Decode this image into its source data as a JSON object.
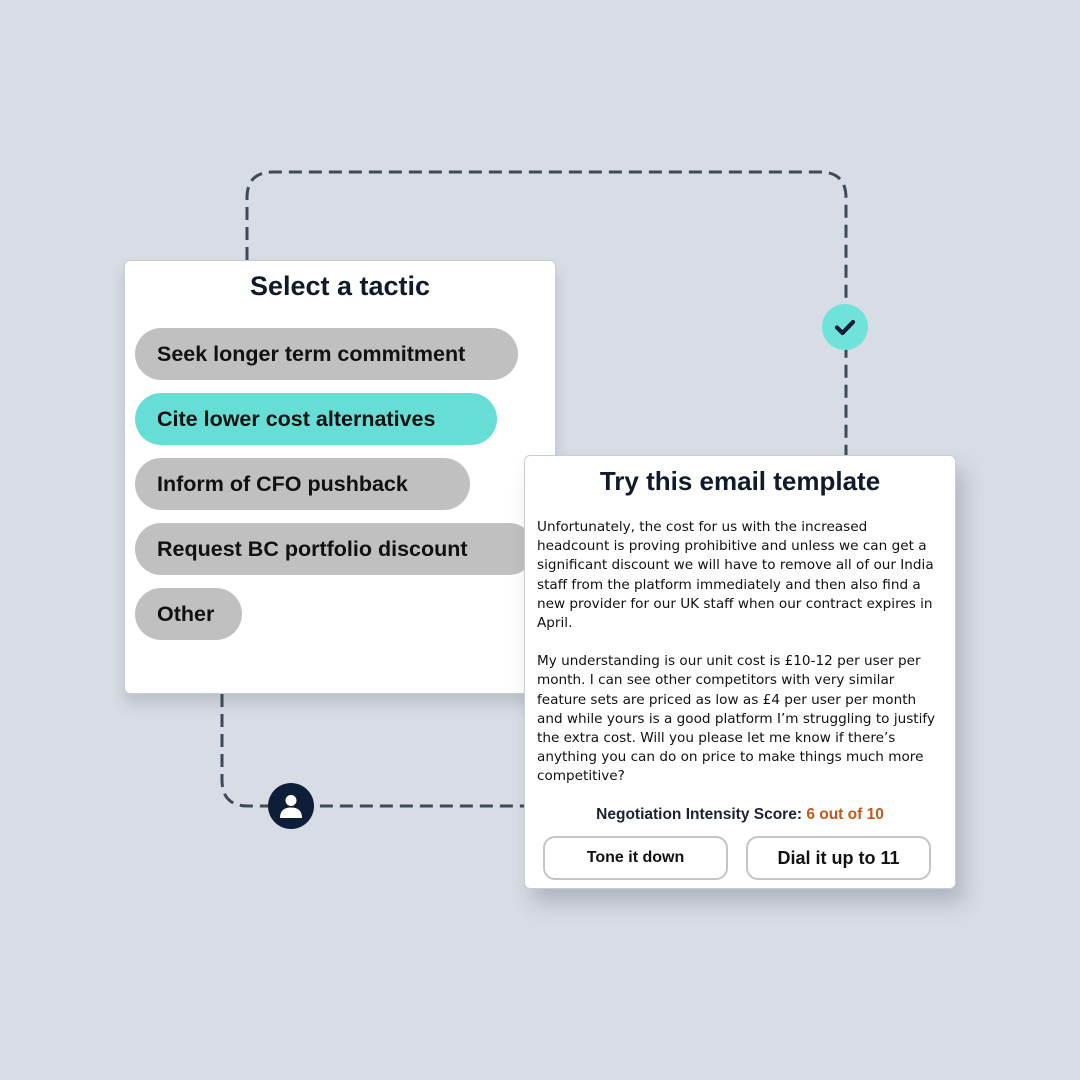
{
  "tactic_panel": {
    "title": "Select a tactic",
    "tactics": [
      {
        "label": "Seek longer term commitment",
        "selected": false
      },
      {
        "label": "Cite lower cost alternatives",
        "selected": true
      },
      {
        "label": "Inform of CFO pushback",
        "selected": false
      },
      {
        "label": "Request BC portfolio discount",
        "selected": false
      },
      {
        "label": "Other",
        "selected": false
      }
    ]
  },
  "email_panel": {
    "title": "Try this email template",
    "paragraphs": [
      "Unfortunately, the cost for us with the increased headcount is proving prohibitive and unless we can get a significant discount we will have to remove all of our India staff from the platform immediately and then also find a new provider for our UK staff when our contract expires in April.",
      "My understanding is our unit cost is £10-12 per user per month. I can see other competitors with very similar feature sets are priced as low as £4 per user per month and while yours is a good platform I’m struggling to justify the extra cost. Will you please let me know if there’s anything you can do on price to make things much more competitive?"
    ],
    "score_label": "Negotiation Intensity Score:",
    "score_value": "6 out of 10",
    "buttons": {
      "tone_down": "Tone it down",
      "dial_up": "Dial it up to 11"
    }
  },
  "flow_nodes": {
    "check": {
      "icon": "check-icon"
    },
    "user": {
      "icon": "user-icon"
    }
  },
  "colors": {
    "background": "#d8dce4",
    "accent_teal": "#66ded5",
    "chip_gray": "#c0c0c0",
    "navy": "#0e1d38",
    "score_orange": "#c25a1c",
    "connector": "#3f4a58"
  }
}
